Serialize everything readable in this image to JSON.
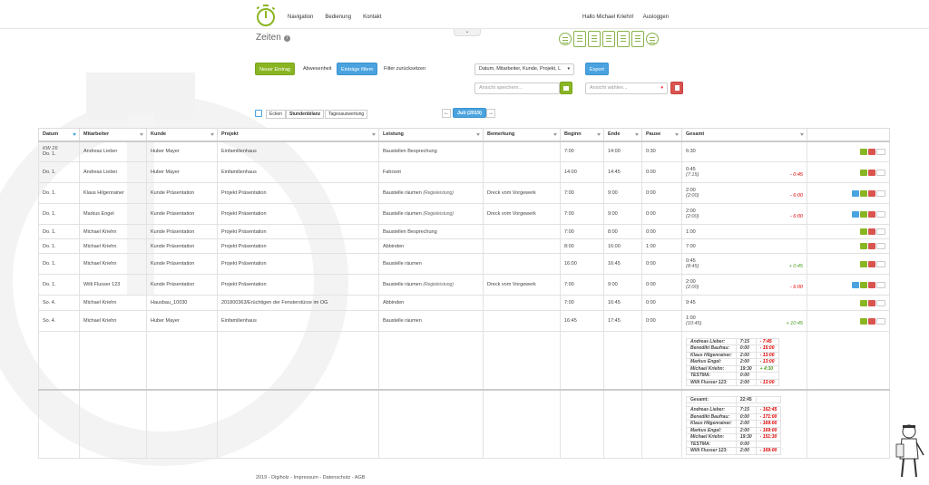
{
  "nav": {
    "links": [
      "Navigation",
      "Bedienung",
      "Kontakt"
    ],
    "greeting": "Hallo Michael Kriehn!",
    "logout": "Ausloggen"
  },
  "page": {
    "title": "Zeiten",
    "tab_icon": "chevron-down-icon"
  },
  "toolbar": {
    "new_entry": "Neuer Eintrag",
    "absent": "Abwesenheit",
    "filter": "Einträge filtern",
    "reset": "Filter zurücksetzen",
    "columns_select": "Datum, Mitarbeiter, Kunde, Projekt, L",
    "export": "Export",
    "save_view_placeholder": "Ansicht speichern...",
    "choose_view_placeholder": "Ansicht wählen..."
  },
  "toggles": [
    "Ecken",
    "Stundenbilanz",
    "Tagesauswertung"
  ],
  "month": "Juli (2019)",
  "colors": {
    "green": "#8ab523",
    "blue": "#4aa3df",
    "red": "#d9534f"
  },
  "table": {
    "headers": [
      "Datum",
      "Mitarbeiter",
      "Kunde",
      "Projekt",
      "Leistung",
      "Bemerkung",
      "Beginn",
      "Ende",
      "Pause",
      "Gesamt",
      ""
    ],
    "rows": [
      {
        "date_top": "KW 26",
        "date": "Do. 1.",
        "employee": "Andreas Lieber",
        "client": "Huber Mayer",
        "project": "Einfamilienhaus",
        "service": "Baustellen Besprechung",
        "service_note": "",
        "remark": "",
        "start": "7:00",
        "end": "14:00",
        "pause": "0:30",
        "total": "6:30",
        "total_sub": "",
        "diff": "",
        "diff_type": "",
        "copy": false
      },
      {
        "date_top": "",
        "date": "Do. 1.",
        "employee": "Andreas Lieber",
        "client": "Huber Mayer",
        "project": "Einfamilienhaus",
        "service": "Fahrzeit",
        "service_note": "",
        "remark": "",
        "start": "14:00",
        "end": "14:45",
        "pause": "0:00",
        "total": "0:45",
        "total_sub": "(7:15)",
        "diff": "- 0:45",
        "diff_type": "neg",
        "copy": false
      },
      {
        "date_top": "",
        "date": "Do. 1.",
        "employee": "Klaus Hilgenrainer",
        "client": "Kunde Präsentation",
        "project": "Projekt Präsentation",
        "service": "Baustelle räumen",
        "service_note": "(Regieleistung)",
        "remark": "Dreck vom Vorgewerk",
        "start": "7:00",
        "end": "9:00",
        "pause": "0:00",
        "total": "2:00",
        "total_sub": "(2:00)",
        "diff": "- 6:00",
        "diff_type": "neg",
        "copy": true
      },
      {
        "date_top": "",
        "date": "Do. 1.",
        "employee": "Markus Engel",
        "client": "Kunde Präsentation",
        "project": "Projekt Präsentation",
        "service": "Baustelle räumen",
        "service_note": "(Regieleistung)",
        "remark": "Dreck vom Vorgewerk",
        "start": "7:00",
        "end": "9:00",
        "pause": "0:00",
        "total": "2:00",
        "total_sub": "(2:00)",
        "diff": "- 6:00",
        "diff_type": "neg",
        "copy": true
      },
      {
        "date_top": "",
        "date": "Do. 1.",
        "employee": "Michael Kriehn",
        "client": "Kunde Präsentation",
        "project": "Projekt Präsentation",
        "service": "Baustellen Besprechung",
        "service_note": "",
        "remark": "",
        "start": "7:00",
        "end": "8:00",
        "pause": "0:00",
        "total": "1:00",
        "total_sub": "",
        "diff": "",
        "diff_type": "",
        "copy": false
      },
      {
        "date_top": "",
        "date": "Do. 1.",
        "employee": "Michael Kriehn",
        "client": "Kunde Präsentation",
        "project": "Projekt Präsentation",
        "service": "Abbinden",
        "service_note": "",
        "remark": "",
        "start": "8:00",
        "end": "16:00",
        "pause": "1:00",
        "total": "7:00",
        "total_sub": "",
        "diff": "",
        "diff_type": "",
        "copy": false
      },
      {
        "date_top": "",
        "date": "Do. 1.",
        "employee": "Michael Kriehn",
        "client": "Kunde Präsentation",
        "project": "Projekt Präsentation",
        "service": "Baustelle räumen",
        "service_note": "",
        "remark": "",
        "start": "16:00",
        "end": "16:45",
        "pause": "0:00",
        "total": "0:45",
        "total_sub": "(8:45)",
        "diff": "+ 0:45",
        "diff_type": "pos",
        "copy": false
      },
      {
        "date_top": "",
        "date": "Do. 1.",
        "employee": "Willi Flusser 123",
        "client": "Kunde Präsentation",
        "project": "Projekt Präsentation",
        "service": "Baustelle räumen",
        "service_note": "(Regieleistung)",
        "remark": "Dreck vom Vorgewerk",
        "start": "7:00",
        "end": "9:00",
        "pause": "0:00",
        "total": "2:00",
        "total_sub": "(2:00)",
        "diff": "- 6:00",
        "diff_type": "neg",
        "copy": true
      },
      {
        "date_top": "",
        "date": "So. 4.",
        "employee": "Michael Kriehn",
        "client": "Hausbau_10030",
        "project": "201800363/Erüchtigen der Fensterstürze im OG",
        "service": "Abbinden",
        "service_note": "",
        "remark": "",
        "start": "7:00",
        "end": "16:45",
        "pause": "0:00",
        "total": "9:45",
        "total_sub": "",
        "diff": "",
        "diff_type": "",
        "copy": false
      },
      {
        "date_top": "",
        "date": "So. 4.",
        "employee": "Michael Kriehn",
        "client": "Huber Mayer",
        "project": "Einfamilienhaus",
        "service": "Baustelle räumen",
        "service_note": "",
        "remark": "",
        "start": "16:45",
        "end": "17:45",
        "pause": "0:00",
        "total": "1:00",
        "total_sub": "(10:45)",
        "diff": "+ 10:45",
        "diff_type": "pos",
        "copy": false
      }
    ],
    "summary1": [
      {
        "name": "Andreas Lieber:",
        "hours": "7:15",
        "diff": "- 7:45",
        "type": "n"
      },
      {
        "name": "Benedikt Baufrau:",
        "hours": "0:00",
        "diff": "- 15:00",
        "type": "n"
      },
      {
        "name": "Klaus Hilgenrainer:",
        "hours": "2:00",
        "diff": "- 13:00",
        "type": "n"
      },
      {
        "name": "Markus Engel:",
        "hours": "2:00",
        "diff": "- 13:00",
        "type": "n"
      },
      {
        "name": "Michael Kriehn:",
        "hours": "19:30",
        "diff": "+ 4:30",
        "type": "p"
      },
      {
        "name": "TESTMA:",
        "hours": "0:00",
        "diff": "",
        "type": "n"
      },
      {
        "name": "Willi Flusser 123:",
        "hours": "2:00",
        "diff": "- 13:00",
        "type": "n"
      }
    ],
    "summary2_total_label": "Gesamt:",
    "summary2_total": "22:45",
    "summary2": [
      {
        "name": "Andreas Lieber:",
        "hours": "7:15",
        "diff": "- 162:45",
        "type": "n"
      },
      {
        "name": "Benedikt Baufrau:",
        "hours": "0:00",
        "diff": "- 171:00",
        "type": "n"
      },
      {
        "name": "Klaus Hilgenrainer:",
        "hours": "2:00",
        "diff": "- 169:00",
        "type": "n"
      },
      {
        "name": "Markus Engel:",
        "hours": "2:00",
        "diff": "- 169:00",
        "type": "n"
      },
      {
        "name": "Michael Kriehn:",
        "hours": "19:30",
        "diff": "- 151:30",
        "type": "n"
      },
      {
        "name": "TESTMA:",
        "hours": "0:00",
        "diff": "",
        "type": "n"
      },
      {
        "name": "Willi Flusser 123:",
        "hours": "2:00",
        "diff": "- 169:00",
        "type": "n"
      }
    ]
  },
  "footer": "2019 - Digiholz - Impressum - Datenschutz - AGB"
}
